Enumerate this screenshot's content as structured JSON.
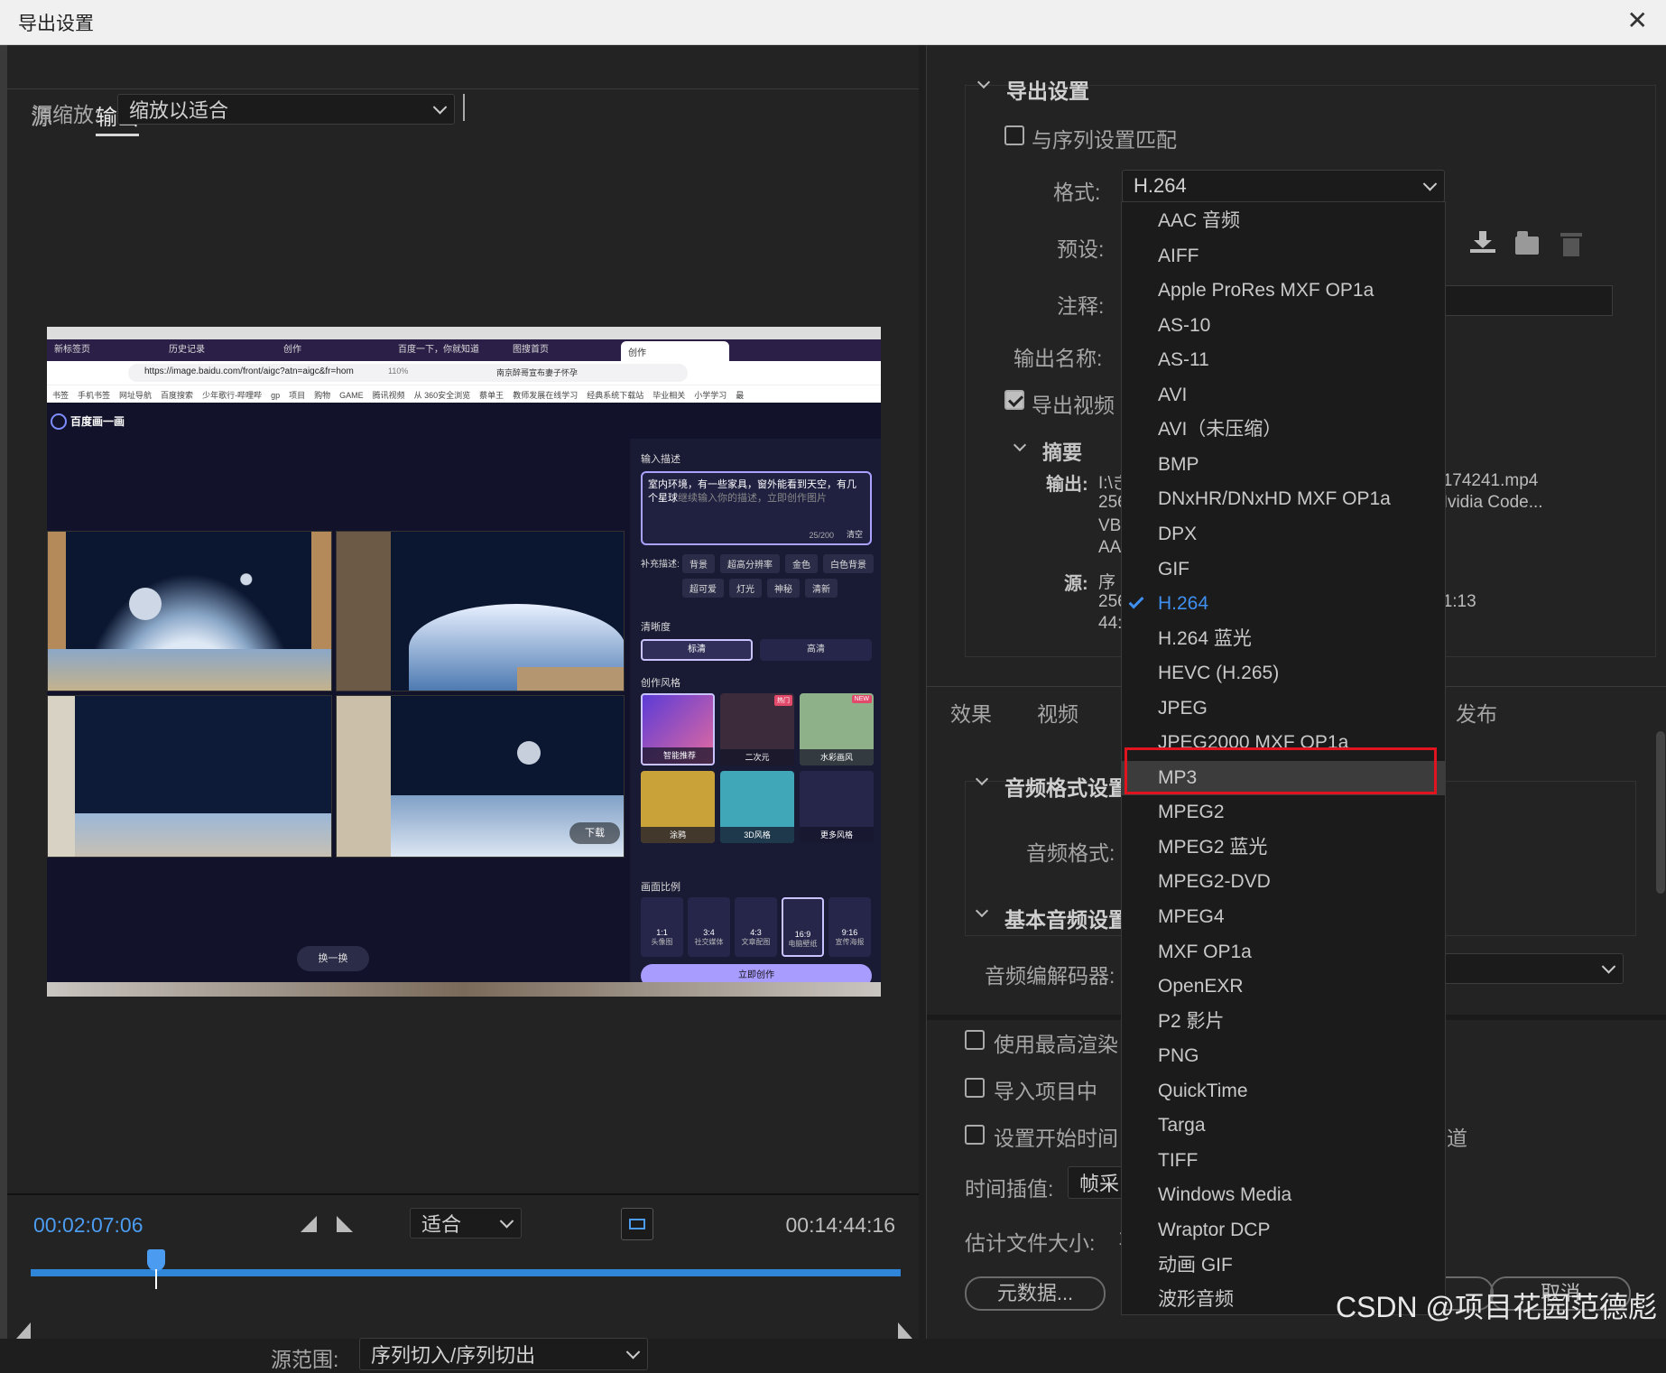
{
  "window": {
    "title": "导出设置",
    "close_glyph": "✕"
  },
  "left": {
    "tabs": [
      "源",
      "输出"
    ],
    "source_scale_label": "源缩放:",
    "source_scale_value": "缩放以适合",
    "timecode_current": "00:02:07:06",
    "timecode_end": "00:14:44:16",
    "fit_value": "适合",
    "range_label": "源范围:",
    "range_value": "序列切入/序列切出",
    "playhead_fraction": 0.144
  },
  "preview": {
    "browser_tabs": [
      "新标签页",
      "历史记录",
      "创作",
      "百度一下，你就知道",
      "图搜首页",
      "创作"
    ],
    "url": "https://image.baidu.com/front/aigc?atn=aigc&fr=hom",
    "zoom": "110%",
    "address_extra": "南京醉哥宣布妻子怀孕",
    "bookmarks": [
      "书签",
      "手机书签",
      "网址导航",
      "百度搜索",
      "少年歌行-哔哩哔",
      "gp",
      "项目",
      "购物",
      "GAME",
      "腾讯视频",
      "从 360安全浏览",
      "蔡单王",
      "教师发展在线学习",
      "经典系统下载站",
      "毕业相关",
      "小学学习",
      "最"
    ],
    "brand": "百度画一画",
    "input_label": "输入描述",
    "prompt_text": "室内环境，有一些家具，窗外能看到天空，有几个星球",
    "prompt_placeholder": "继续输入你的描述，立即创作图片",
    "char_count": "25/200",
    "clear": "清空",
    "supplement_label": "补充描述:",
    "chips": [
      "背景",
      "超高分辨率",
      "金色",
      "白色背景",
      "超可爱",
      "灯光",
      "神秘",
      "清新"
    ],
    "clarity_label": "清晰度",
    "clarity": [
      "标清",
      "高清"
    ],
    "style_label": "创作风格",
    "styles": [
      "智能推荐",
      "二次元",
      "水彩画风",
      "涂鸦",
      "3D风格",
      "更多风格"
    ],
    "style_badges": [
      "热门",
      "NEW"
    ],
    "ratio_label": "画面比例",
    "ratios": [
      {
        "r": "1:1",
        "d": "头像图"
      },
      {
        "r": "3:4",
        "d": "社交媒体"
      },
      {
        "r": "4:3",
        "d": "文章配图"
      },
      {
        "r": "16:9",
        "d": "电脑壁纸"
      },
      {
        "r": "9:16",
        "d": "宣传海报"
      }
    ],
    "create": "立即创作",
    "swap": "换一换",
    "download": "下载"
  },
  "right": {
    "export_settings": "导出设置",
    "match_sequence": "与序列设置匹配",
    "format_label": "格式:",
    "format_value": "H.264",
    "preset_label": "预设:",
    "comment_label": "注释:",
    "output_name_label": "输出名称:",
    "export_video": "导出视频",
    "summary": "摘要",
    "output_label": "输出:",
    "output_line1": "I:\\ぎ",
    "output_line1_tail": "08_174241.mp4",
    "output_line2": "256",
    "output_line2_tail": "E, Nvidia Code...",
    "output_line3": "VB",
    "output_line4": "AAC",
    "source_label": "源:",
    "source_line1": "序",
    "source_line2": "256",
    "source_line2_tail": ".4:41:13",
    "source_line3": "44:",
    "tabs": [
      "效果",
      "视频",
      "发布"
    ],
    "audio_format_settings": "音频格式设置",
    "audio_format_label": "音频格式:",
    "basic_audio_settings": "基本音频设置",
    "audio_codec_label": "音频编解码器:",
    "use_max_render": "使用最高渲染",
    "import_project": "导入项目中",
    "set_start_time": "设置开始时间",
    "channel_tail": "道",
    "time_interp_label": "时间插值:",
    "time_interp_value": "帧采",
    "est_size_label": "估计文件大小:",
    "est_size_value": "1",
    "metadata_btn": "元数据...",
    "cancel_btn": "取消"
  },
  "format_options": [
    "AAC 音频",
    "AIFF",
    "Apple ProRes MXF OP1a",
    "AS-10",
    "AS-11",
    "AVI",
    "AVI（未压缩）",
    "BMP",
    "DNxHR/DNxHD MXF OP1a",
    "DPX",
    "GIF",
    "H.264",
    "H.264 蓝光",
    "HEVC (H.265)",
    "JPEG",
    "JPEG2000 MXF OP1a",
    "MP3",
    "MPEG2",
    "MPEG2 蓝光",
    "MPEG2-DVD",
    "MPEG4",
    "MXF OP1a",
    "OpenEXR",
    "P2 影片",
    "PNG",
    "QuickTime",
    "Targa",
    "TIFF",
    "Windows Media",
    "Wraptor DCP",
    "动画 GIF",
    "波形音频"
  ],
  "selected_format": "H.264",
  "highlighted_format": "MP3",
  "watermark": "CSDN @项目花园范德彪",
  "colors": {
    "accent": "#3f8ff0",
    "highlight_box": "#e0141e",
    "panel": "#232323"
  }
}
